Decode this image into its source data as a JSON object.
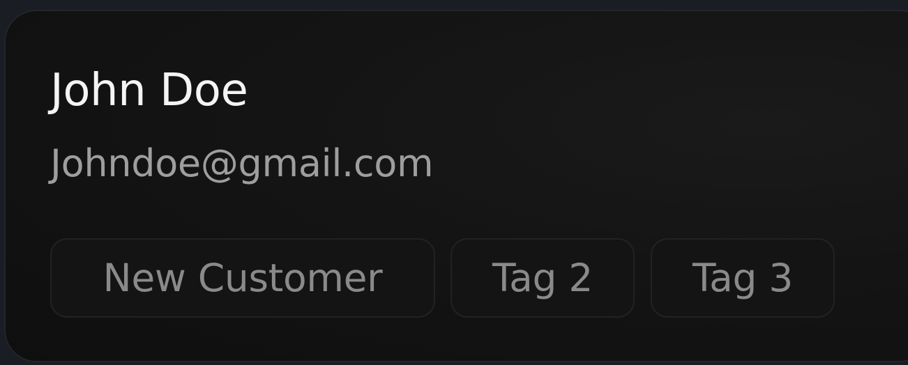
{
  "contact": {
    "name": "John Doe",
    "email": "Johndoe@gmail.com"
  },
  "tags": [
    {
      "label": "New Customer"
    },
    {
      "label": "Tag 2"
    },
    {
      "label": "Tag 3"
    }
  ],
  "colors": {
    "background": "#1b1d24",
    "card": "#141414",
    "name_text": "#f4f4f4",
    "email_text": "#9e9e9e",
    "tag_text": "#8a8a8a",
    "tag_border": "#222222"
  }
}
